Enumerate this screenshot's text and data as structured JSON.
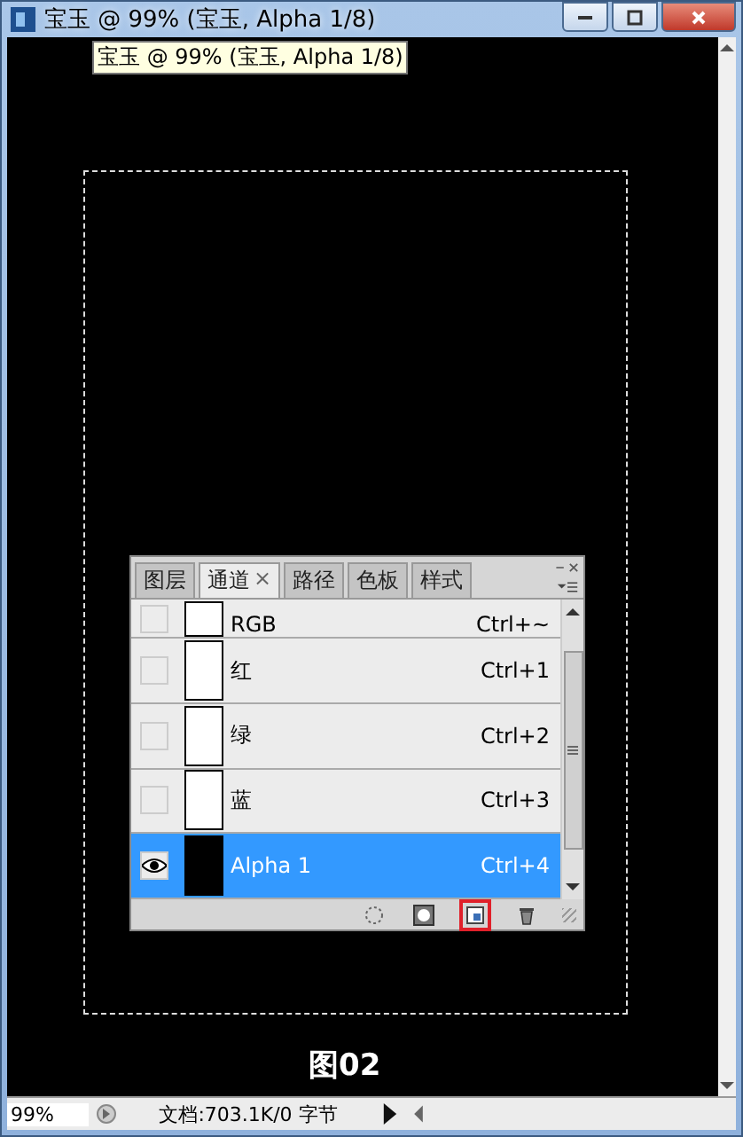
{
  "window": {
    "title": "宝玉 @ 99% (宝玉, Alpha 1/8)",
    "tooltip": "宝玉 @ 99% (宝玉, Alpha 1/8)"
  },
  "canvas": {
    "caption": "图02"
  },
  "panel": {
    "tabs": [
      {
        "label": "图层",
        "selected": false
      },
      {
        "label": "通道",
        "selected": true
      },
      {
        "label": "路径",
        "selected": false
      },
      {
        "label": "色板",
        "selected": false
      },
      {
        "label": "样式",
        "selected": false
      }
    ],
    "close_glyph": "×",
    "channels": [
      {
        "name": "RGB",
        "shortcut": "Ctrl+~",
        "visible": false,
        "selected": false,
        "thumb_dark": false,
        "partial": true
      },
      {
        "name": "红",
        "shortcut": "Ctrl+1",
        "visible": false,
        "selected": false,
        "thumb_dark": false,
        "partial": false
      },
      {
        "name": "绿",
        "shortcut": "Ctrl+2",
        "visible": false,
        "selected": false,
        "thumb_dark": false,
        "partial": false
      },
      {
        "name": "蓝",
        "shortcut": "Ctrl+3",
        "visible": false,
        "selected": false,
        "thumb_dark": false,
        "partial": false
      },
      {
        "name": "Alpha 1",
        "shortcut": "Ctrl+4",
        "visible": true,
        "selected": true,
        "thumb_dark": true,
        "partial": false
      }
    ],
    "footer_buttons": [
      {
        "kind": "selection",
        "highlighted": false
      },
      {
        "kind": "mask",
        "highlighted": false
      },
      {
        "kind": "new",
        "highlighted": true
      },
      {
        "kind": "trash",
        "highlighted": false
      }
    ]
  },
  "status_bar": {
    "zoom": "99%",
    "doc_info": "文档:703.1K/0 字节"
  }
}
